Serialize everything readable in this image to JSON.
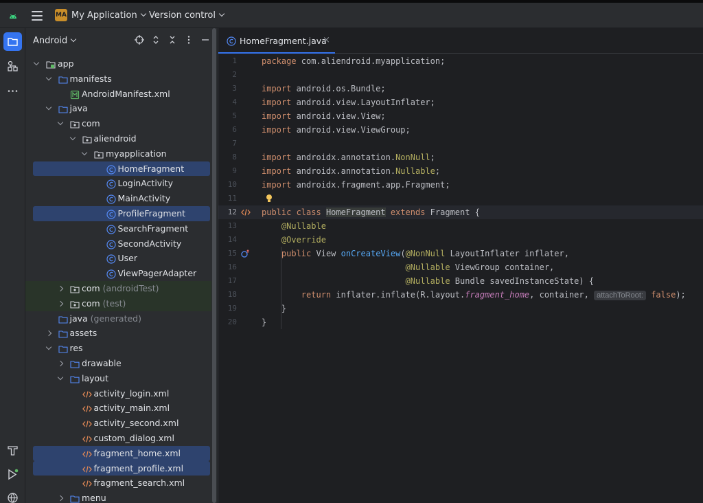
{
  "titlebar": {
    "project_badge": "MA",
    "project_name": "My Application",
    "version_control": "Version control"
  },
  "panel": {
    "title": "Android",
    "tools": [
      "crosshair-icon",
      "expand-icon",
      "collapse-icon",
      "more-icon",
      "minimize-icon"
    ]
  },
  "tree": [
    {
      "label": "app",
      "indent": 0,
      "arrow": "down",
      "icon": "module"
    },
    {
      "label": "manifests",
      "indent": 1,
      "arrow": "down",
      "icon": "folder"
    },
    {
      "label": "AndroidManifest.xml",
      "indent": 2,
      "arrow": "",
      "icon": "manifest"
    },
    {
      "label": "java",
      "indent": 1,
      "arrow": "down",
      "icon": "folder"
    },
    {
      "label": "com",
      "indent": 2,
      "arrow": "down",
      "icon": "package"
    },
    {
      "label": "aliendroid",
      "indent": 3,
      "arrow": "down",
      "icon": "package"
    },
    {
      "label": "myapplication",
      "indent": 4,
      "arrow": "down",
      "icon": "package"
    },
    {
      "label": "HomeFragment",
      "indent": 5,
      "arrow": "",
      "icon": "class",
      "selected": true
    },
    {
      "label": "LoginActivity",
      "indent": 5,
      "arrow": "",
      "icon": "class"
    },
    {
      "label": "MainActivity",
      "indent": 5,
      "arrow": "",
      "icon": "class"
    },
    {
      "label": "ProfileFragment",
      "indent": 5,
      "arrow": "",
      "icon": "class",
      "selected": true
    },
    {
      "label": "SearchFragment",
      "indent": 5,
      "arrow": "",
      "icon": "class"
    },
    {
      "label": "SecondActivity",
      "indent": 5,
      "arrow": "",
      "icon": "class"
    },
    {
      "label": "User",
      "indent": 5,
      "arrow": "",
      "icon": "class"
    },
    {
      "label": "ViewPagerAdapter",
      "indent": 5,
      "arrow": "",
      "icon": "class"
    },
    {
      "label": "com",
      "suffix": "(androidTest)",
      "indent": 2,
      "arrow": "right",
      "icon": "package",
      "green": true
    },
    {
      "label": "com",
      "suffix": "(test)",
      "indent": 2,
      "arrow": "right",
      "icon": "package",
      "green": true
    },
    {
      "label": "java",
      "suffix": "(generated)",
      "indent": 1,
      "arrow": "",
      "icon": "folder"
    },
    {
      "label": "assets",
      "indent": 1,
      "arrow": "right",
      "icon": "folder"
    },
    {
      "label": "res",
      "indent": 1,
      "arrow": "down",
      "icon": "folder"
    },
    {
      "label": "drawable",
      "indent": 2,
      "arrow": "right",
      "icon": "folder"
    },
    {
      "label": "layout",
      "indent": 2,
      "arrow": "down",
      "icon": "folder"
    },
    {
      "label": "activity_login.xml",
      "indent": 3,
      "arrow": "",
      "icon": "xml"
    },
    {
      "label": "activity_main.xml",
      "indent": 3,
      "arrow": "",
      "icon": "xml"
    },
    {
      "label": "activity_second.xml",
      "indent": 3,
      "arrow": "",
      "icon": "xml"
    },
    {
      "label": "custom_dialog.xml",
      "indent": 3,
      "arrow": "",
      "icon": "xml"
    },
    {
      "label": "fragment_home.xml",
      "indent": 3,
      "arrow": "",
      "icon": "xml",
      "selected": true
    },
    {
      "label": "fragment_profile.xml",
      "indent": 3,
      "arrow": "",
      "icon": "xml",
      "selected": true
    },
    {
      "label": "fragment_search.xml",
      "indent": 3,
      "arrow": "",
      "icon": "xml"
    },
    {
      "label": "menu",
      "indent": 2,
      "arrow": "right",
      "icon": "folder"
    }
  ],
  "editor": {
    "tab_label": "HomeFragment.java",
    "current_line": 12,
    "lines": [
      "<span class=\"kw\">package</span> com.aliendroid.myapplication;",
      "",
      "<span class=\"kw\">import</span> android.os.Bundle;",
      "<span class=\"kw\">import</span> android.view.LayoutInflater;",
      "<span class=\"kw\">import</span> android.view.View;",
      "<span class=\"kw\">import</span> android.view.ViewGroup;",
      "",
      "<span class=\"kw\">import</span> androidx.annotation.<span class=\"ann\">NonNull</span>;",
      "<span class=\"kw\">import</span> androidx.annotation.<span class=\"ann\">Nullable</span>;",
      "<span class=\"kw\">import</span> androidx.fragment.app.Fragment;",
      "",
      "<span class=\"kw\">public class</span> <span class=\"hl\">HomeFragment</span> <span class=\"kw\">extends</span> Fragment {",
      "    <span class=\"ann\">@Nullable</span>",
      "    <span class=\"ann\">@Override</span>",
      "    <span class=\"kw\">public</span> View <span class=\"fn\">onCreateView</span>(<span class=\"ann\">@NonNull</span> LayoutInflater inflater,",
      "                             <span class=\"ann\">@Nullable</span> ViewGroup container,",
      "                             <span class=\"ann\">@Nullable</span> Bundle savedInstanceState) {",
      "        <span class=\"kw\">return</span> inflater.inflate(R.layout.<span class=\"it\">fragment_home</span>, container, <span class=\"hint\">attachToRoot:</span> <span class=\"kw\">false</span>);",
      "    }",
      "}"
    ]
  }
}
